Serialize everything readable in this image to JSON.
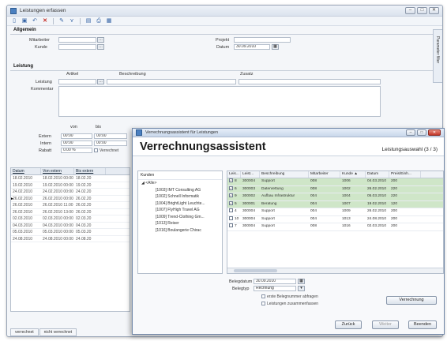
{
  "app": {
    "title": "Leistungen erfassen",
    "window_buttons": [
      "–",
      "□",
      "✕"
    ]
  },
  "toolbar": {
    "icons": [
      "new-icon",
      "save-icon",
      "undo-icon",
      "delete-icon",
      "edit-icon",
      "filter-icon",
      "report-icon",
      "print-icon",
      "export-icon"
    ]
  },
  "sidetab": {
    "label": "Parameter filter"
  },
  "allgemein": {
    "heading": "Allgemein",
    "mitarbeiter_label": "Mitarbeiter",
    "kunde_label": "Kunde",
    "projekt_label": "Projekt",
    "datum_label": "Datum",
    "datum_value": "30.09.2010"
  },
  "leistung": {
    "heading": "Leistung",
    "col_artikel": "Artikel",
    "col_beschreibung": "Beschreibung",
    "col_zusatz": "Zusatz",
    "leistung_label": "Leistung",
    "kommentar_label": "Kommentar"
  },
  "zeiten": {
    "col_von": "von",
    "col_bis": "bis",
    "extern_label": "Extern",
    "extern_von": "00:00",
    "extern_bis": "00:00",
    "intern_label": "Intern",
    "intern_von": "00:00",
    "intern_bis": "00:00",
    "rabatt_label": "Rabatt",
    "rabatt_value": "0.00 %",
    "verrechnet_label": "Verrechnet"
  },
  "grid": {
    "headers": [
      "Datum",
      "Von extern",
      "Bis extern"
    ],
    "rows": [
      [
        "18.02.2010",
        "18.02.2010 00:00",
        "18.02.20"
      ],
      [
        "19.02.2010",
        "19.02.2010 00:00",
        "19.02.20"
      ],
      [
        "24.02.2010",
        "24.02.2010 00:00",
        "24.02.20"
      ],
      [
        "26.02.2010",
        "26.02.2010 00:00",
        "26.02.20"
      ],
      [
        "26.02.2010",
        "26.02.2010 11:00",
        "26.02.20"
      ],
      [
        "26.02.2010",
        "26.02.2010 13:00",
        "26.02.20"
      ],
      [
        "02.03.2010",
        "02.03.2010 00:00",
        "02.03.20"
      ],
      [
        "04.03.2010",
        "04.03.2010 00:00",
        "04.03.20"
      ],
      [
        "05.03.2010",
        "05.03.2010 00:00",
        "05.03.20"
      ],
      [
        "24.08.2010",
        "24.08.2010 00:00",
        "24.08.20"
      ]
    ]
  },
  "bottom_tabs": [
    "verrechnet",
    "nicht verrechnet"
  ],
  "dialog": {
    "title": "Verrechnungsassistent für Leistungen",
    "heading": "Verrechnungsassistent",
    "step": "Leistungsauswahl (3 / 3)",
    "tree_header": "Kunden",
    "tree_root": "<Alle>",
    "tree_items": [
      "[1003] IMT Consulting AG",
      "[1002] Schnell Informatik",
      "[1004] BrightLight Leuchte...",
      "[1007] FlyHigh Travel AG",
      "[1009] Trend-Clothing Gm...",
      "[1013] Reiser",
      "[1016] Boulangerie Chirac"
    ],
    "table_headers": [
      "Leis...",
      "Leist...",
      "Beschreibung",
      "Mitarbeiter",
      "Kunde",
      "Datum",
      "Preis/Einh..."
    ],
    "table_rows": [
      {
        "checked": true,
        "nr": "8",
        "leist": "300004",
        "beschreibung": "Support",
        "mitarbeiter": "008",
        "kunde": "1006",
        "datum": "04.03.2010",
        "preis": "200",
        "green": true
      },
      {
        "checked": true,
        "nr": "6",
        "leist": "300003",
        "beschreibung": "Datenrettung",
        "mitarbeiter": "008",
        "kunde": "1002",
        "datum": "26.02.2010",
        "preis": "220",
        "green": true
      },
      {
        "checked": true,
        "nr": "9",
        "leist": "300002",
        "beschreibung": "Aufbau Infrastruktur",
        "mitarbeiter": "004",
        "kunde": "1004",
        "datum": "05.03.2010",
        "preis": "220",
        "green": true
      },
      {
        "checked": true,
        "nr": "5",
        "leist": "300001",
        "beschreibung": "Beratung",
        "mitarbeiter": "004",
        "kunde": "1007",
        "datum": "19.02.2010",
        "preis": "120",
        "green": true
      },
      {
        "checked": false,
        "nr": "4",
        "leist": "300004",
        "beschreibung": "Support",
        "mitarbeiter": "004",
        "kunde": "1009",
        "datum": "26.02.2010",
        "preis": "200",
        "green": false
      },
      {
        "checked": false,
        "nr": "10",
        "leist": "300004",
        "beschreibung": "Support",
        "mitarbeiter": "004",
        "kunde": "1013",
        "datum": "24.08.2010",
        "preis": "200",
        "green": false
      },
      {
        "checked": false,
        "nr": "7",
        "leist": "300004",
        "beschreibung": "Support",
        "mitarbeiter": "008",
        "kunde": "1016",
        "datum": "02.03.2010",
        "preis": "200",
        "green": false
      }
    ],
    "belegdatum_label": "Belegdatum",
    "belegdatum_value": "30.09.2010",
    "belegtyp_label": "Belegtyp",
    "belegtyp_value": "Rechnung",
    "check_erste": "erste Belegnummer abfragen",
    "check_zusammen": "Leistungen zusammenfassen",
    "btn_verrechnung": "Verrechnung",
    "btn_zurueck": "Zurück",
    "btn_weiter": "Weiter",
    "btn_beenden": "Beenden"
  },
  "colors": {
    "accent": "#2f5fa3",
    "row_green": "#cfe6c8",
    "grid_text": "#555555"
  }
}
